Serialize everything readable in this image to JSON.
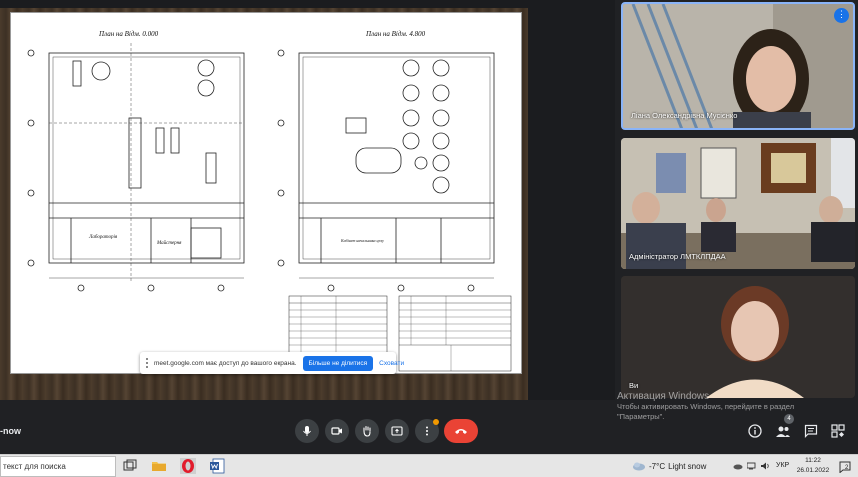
{
  "presentation": {
    "plan_left_title": "План на Відм. 0.000",
    "plan_right_title": "План на Відм. 4.800",
    "room_labels": [
      "Лабораторія",
      "Майстерня",
      "Кабінет начальника цеху"
    ],
    "share_notice": {
      "text": "meet.google.com має доступ до вашого екрана.",
      "stop_label": "Більше не ділитися",
      "hide_label": "Сховати"
    }
  },
  "tiles": [
    {
      "name": "Ліана Олександрівна Мусієнко"
    },
    {
      "name": "Адміністратор ЛМТКЛПДАА"
    },
    {
      "name": "Ви"
    }
  ],
  "activation": {
    "title": "Активация Windows",
    "subtitle": "Чтобы активировать Windows, перейдите в раздел \"Параметры\"."
  },
  "controls": {
    "meeting_code": "-now",
    "people_count": "4"
  },
  "taskbar": {
    "search_placeholder": "текст для поиска",
    "weather_temp": "-7°C",
    "weather_text": "Light snow",
    "language": "УКР",
    "time": "11:22",
    "date": "26.01.2022",
    "notifications": "2"
  },
  "colors": {
    "accent": "#1a73e8",
    "end_call": "#ea4335",
    "active_speaker_border": "#8ab4f8",
    "background": "#202124"
  }
}
